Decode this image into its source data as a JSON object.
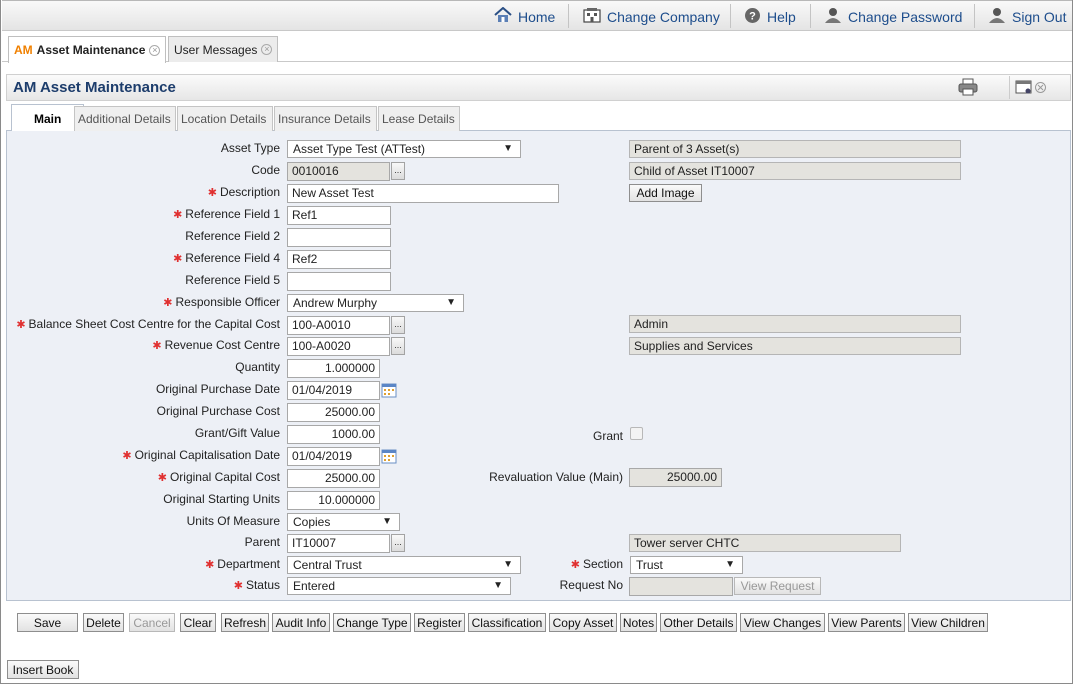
{
  "topnav": {
    "home": "Home",
    "change_company": "Change Company",
    "help": "Help",
    "change_password": "Change Password",
    "sign_out": "Sign Out"
  },
  "page_tabs": {
    "asset_prefix": "AM",
    "asset_label": "Asset Maintenance",
    "messages_label": "User Messages"
  },
  "panel": {
    "title": "AM Asset Maintenance"
  },
  "inner_tabs": [
    "Main",
    "Additional Details",
    "Location Details",
    "Insurance Details",
    "Lease Details"
  ],
  "form": {
    "asset_type": {
      "label": "Asset Type",
      "value": "Asset Type Test (ATTest)",
      "info": "Parent of 3 Asset(s)"
    },
    "code": {
      "label": "Code",
      "value": "0010016",
      "info": "Child of Asset IT10007"
    },
    "description": {
      "label": "Description",
      "value": "New Asset Test",
      "button": "Add Image"
    },
    "ref1": {
      "label": "Reference Field 1",
      "value": "Ref1"
    },
    "ref2": {
      "label": "Reference Field 2",
      "value": ""
    },
    "ref4": {
      "label": "Reference Field 4",
      "value": "Ref2"
    },
    "ref5": {
      "label": "Reference Field 5",
      "value": ""
    },
    "officer": {
      "label": "Responsible Officer",
      "value": "Andrew Murphy"
    },
    "bs_cost_centre": {
      "label": "Balance Sheet Cost Centre for the Capital Cost",
      "value": "100-A0010",
      "info": "Admin"
    },
    "rev_cost_centre": {
      "label": "Revenue Cost Centre",
      "value": "100-A0020",
      "info": "Supplies and Services"
    },
    "quantity": {
      "label": "Quantity",
      "value": "1.000000"
    },
    "purchase_date": {
      "label": "Original Purchase Date",
      "value": "01/04/2019"
    },
    "purchase_cost": {
      "label": "Original Purchase Cost",
      "value": "25000.00"
    },
    "grant_value": {
      "label": "Grant/Gift Value",
      "value": "1000.00",
      "grant_label": "Grant",
      "grant_checked": false
    },
    "cap_date": {
      "label": "Original Capitalisation Date",
      "value": "01/04/2019"
    },
    "cap_cost": {
      "label": "Original Capital Cost",
      "value": "25000.00",
      "reval_label": "Revaluation Value (Main)",
      "reval_value": "25000.00"
    },
    "start_units": {
      "label": "Original Starting Units",
      "value": "10.000000"
    },
    "uom": {
      "label": "Units Of Measure",
      "value": "Copies"
    },
    "parent": {
      "label": "Parent",
      "value": "IT10007",
      "info": "Tower server CHTC"
    },
    "department": {
      "label": "Department",
      "value": "Central Trust",
      "section_label": "Section",
      "section_value": "Trust"
    },
    "status": {
      "label": "Status",
      "value": "Entered",
      "request_label": "Request No",
      "request_value": "",
      "view_request": "View Request"
    },
    "lookup_glyph": "..."
  },
  "actions": [
    "Save",
    "Delete",
    "Cancel",
    "Clear",
    "Refresh",
    "Audit Info",
    "Change Type",
    "Register",
    "Classification",
    "Copy Asset",
    "Notes",
    "Other Details",
    "View Changes",
    "View Parents",
    "View Children"
  ],
  "insert_book": "Insert Book",
  "colors": {
    "title": "#1d3d6c",
    "link": "#1d4d8c",
    "required": "#e03030",
    "form_bg": "#edf0f6",
    "accent": "#f08000"
  }
}
